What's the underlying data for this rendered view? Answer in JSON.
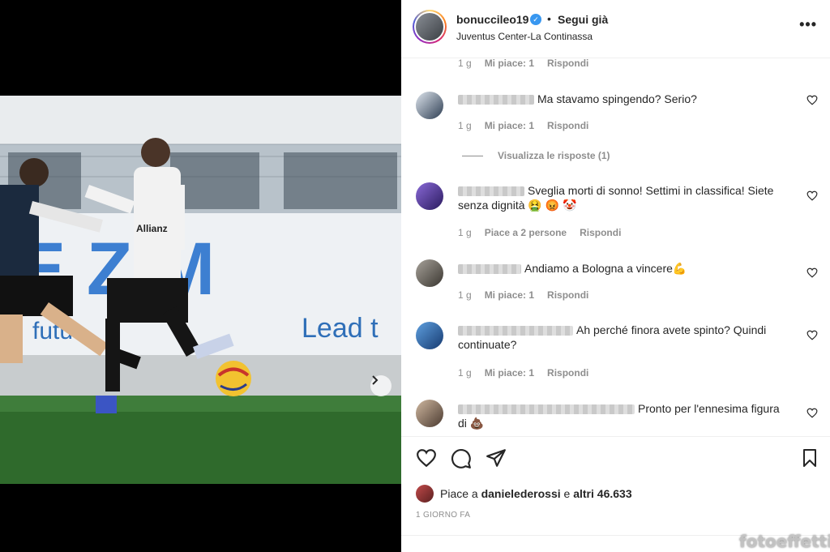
{
  "post": {
    "username": "bonuccileo19",
    "dot": "•",
    "follow_label": "Segui già",
    "location": "Juventus Center-La Continassa",
    "more_label": "•••"
  },
  "photo": {
    "sign_letters": "E Z M",
    "sign_tagline": "Lead t",
    "sign_left": "futu",
    "shirt_text": "Allianz",
    "carousel_pages": 3,
    "carousel_active": 1
  },
  "comments": {
    "top_meta": {
      "time": "1 g",
      "likes": "Mi piace: 1",
      "reply": "Rispondi"
    },
    "items": [
      {
        "text": "Ma stavamo spingendo? Serio?",
        "time": "1 g",
        "likes": "Mi piace: 1",
        "reply": "Rispondi"
      },
      {
        "text": "Sveglia morti di sonno! Settimi in classifica! Siete senza dignità 🤮 😡 🤡",
        "time": "1 g",
        "likes": "Piace a 2 persone",
        "reply": "Rispondi"
      },
      {
        "text": "Andiamo a Bologna a vincere💪",
        "time": "1 g",
        "likes": "Mi piace: 1",
        "reply": "Rispondi"
      },
      {
        "text": "Ah perché finora avete spinto? Quindi continuate?",
        "time": "1 g",
        "likes": "Mi piace: 1",
        "reply": "Rispondi"
      },
      {
        "text": "Pronto per l'ennesima figura di 💩"
      }
    ],
    "view_replies": "Visualizza le risposte (1)"
  },
  "actions": {
    "icons": [
      "heart-icon",
      "comment-icon",
      "share-icon",
      "bookmark-icon"
    ]
  },
  "likes": {
    "prefix": "Piace a",
    "user": "danielederossi",
    "middle": "e",
    "others": "altri 46.633"
  },
  "time_ago": "1 GIORNO FA",
  "watermark": "fotoeffetti",
  "colors": {
    "verified": "#3897f0",
    "muted": "#8e8e8e",
    "text": "#262626"
  }
}
